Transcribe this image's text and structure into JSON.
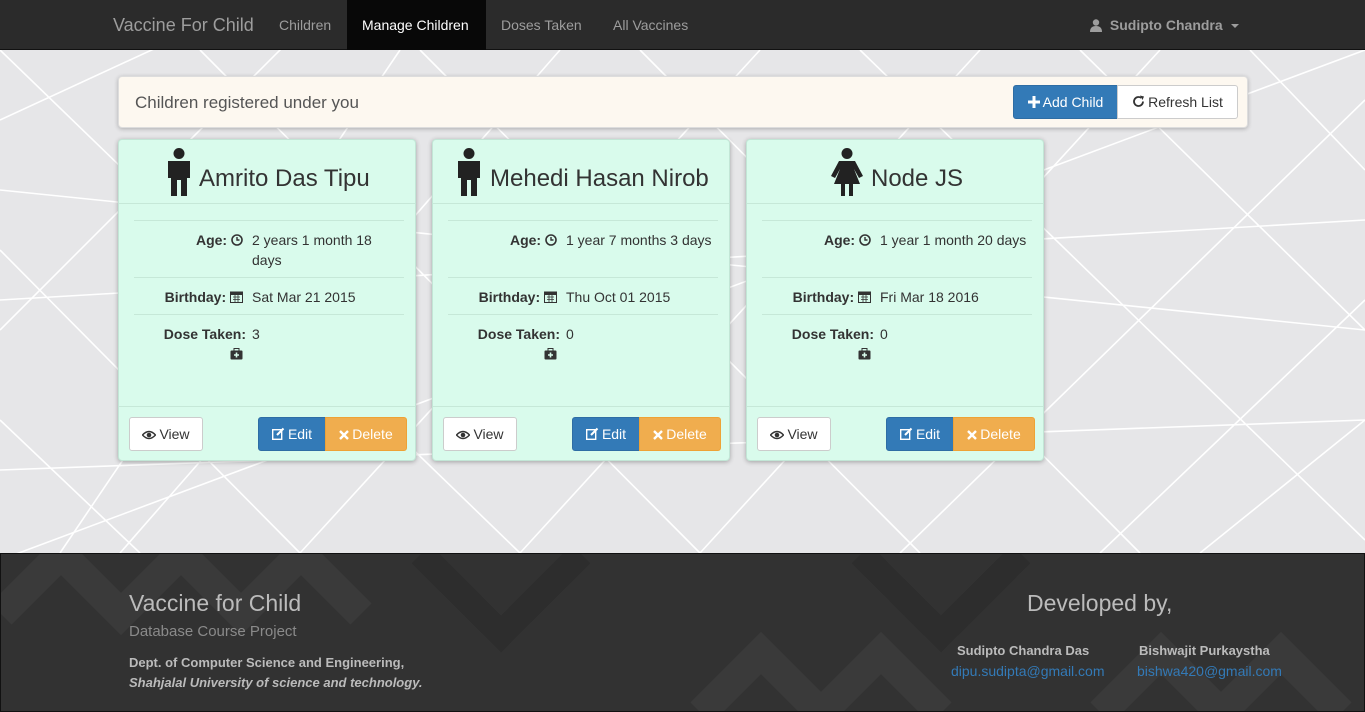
{
  "navbar": {
    "brand": "Vaccine For Child",
    "links": [
      "Children",
      "Manage Children",
      "Doses Taken",
      "All Vaccines"
    ],
    "active": "Manage Children",
    "user": "Sudipto Chandra"
  },
  "header": {
    "title": "Children registered under you",
    "add_label": "Add Child",
    "refresh_label": "Refresh List"
  },
  "labels": {
    "age": "Age:",
    "birthday": "Birthday:",
    "dose": "Dose Taken:",
    "view": "View",
    "edit": "Edit",
    "delete": "Delete"
  },
  "children": [
    {
      "name": "Amrito Das Tipu",
      "gender_icon": "male-icon",
      "age": "2 years 1 month 18 days",
      "birthday": "Sat Mar 21 2015",
      "doses": "3"
    },
    {
      "name": "Mehedi Hasan Nirob",
      "gender_icon": "male-icon",
      "age": "1 year 7 months 3 days",
      "birthday": "Thu Oct 01 2015",
      "doses": "0"
    },
    {
      "name": "Node JS",
      "gender_icon": "female-icon",
      "age": "1 year 1 month 20 days",
      "birthday": "Fri Mar 18 2016",
      "doses": "0"
    }
  ],
  "footer": {
    "title": "Vaccine for Child",
    "subtitle": "Database Course Project",
    "dept": "Dept. of Computer Science and Engineering,",
    "university": "Shahjalal University of science and technology.",
    "developed_by": "Developed by,",
    "developers": [
      {
        "name": "Sudipto Chandra Das",
        "email": "dipu.sudipta@gmail.com"
      },
      {
        "name": "Bishwajit Purkaystha",
        "email": "bishwa420@gmail.com"
      }
    ]
  },
  "colors": {
    "navbar": "#2b2b2b",
    "card": "#d9fbec",
    "primary": "#337ab7",
    "warning": "#f0ad4e",
    "footer": "#323232"
  }
}
